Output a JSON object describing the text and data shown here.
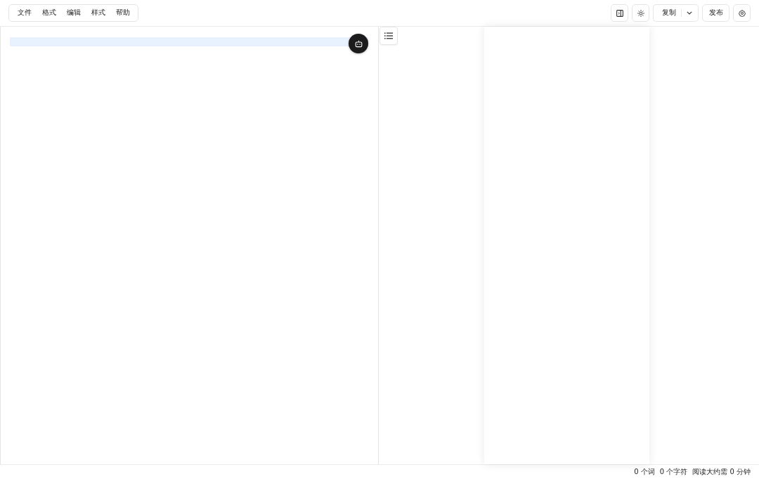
{
  "menu_bar": {
    "items": [
      {
        "label": "文件"
      },
      {
        "label": "格式"
      },
      {
        "label": "编辑"
      },
      {
        "label": "样式"
      },
      {
        "label": "帮助"
      }
    ]
  },
  "toolbar": {
    "copy_label": "复制",
    "publish_label": "发布"
  },
  "status_bar": {
    "items": [
      "0 个词",
      "0 个字符",
      "阅读大约需 0 分钟"
    ]
  }
}
